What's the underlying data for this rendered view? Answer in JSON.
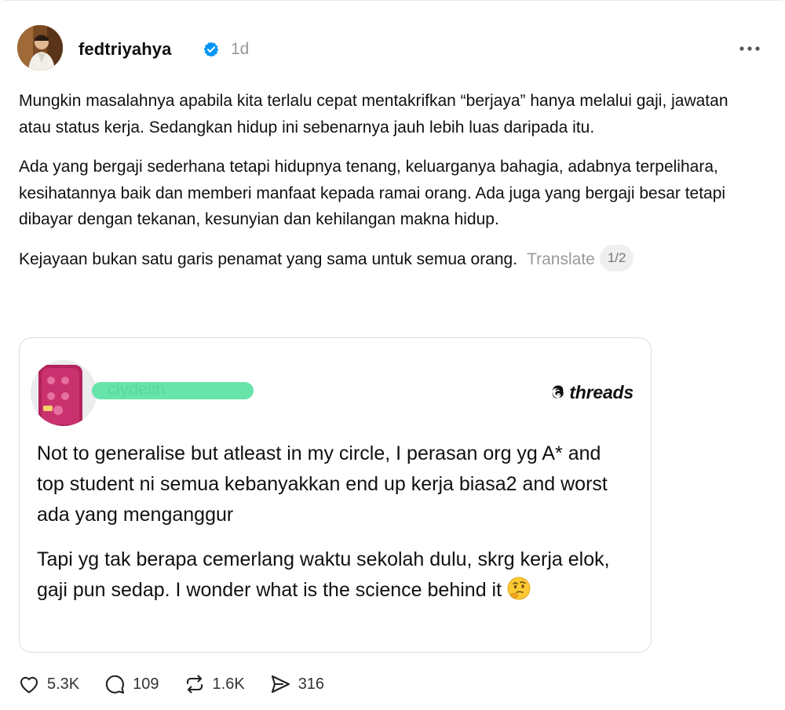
{
  "post": {
    "username": "fedtriyahya",
    "timestamp": "1d",
    "paragraphs": [
      "Mungkin masalahnya apabila kita terlalu cepat mentakrifkan “berjaya” hanya melalui gaji, jawatan atau status kerja. Sedangkan hidup ini sebenarnya jauh lebih luas daripada itu.",
      "Ada yang bergaji sederhana tetapi hidupnya tenang, keluarganya bahagia, adabnya terpelihara, kesihatannya baik dan memberi manfaat kepada ramai orang. Ada juga yang bergaji besar tetapi dibayar dengan tekanan, kesunyian dan kehilangan makna hidup.",
      "Kejayaan bukan satu garis penamat yang sama untuk semua orang."
    ],
    "translate_label": "Translate",
    "page_indicator": "1/2"
  },
  "quote": {
    "brand": "threads",
    "username": "clydelin",
    "paragraphs": [
      "Not to generalise but atleast in my circle, I perasan org yg A* and top student ni semua kebanyakkan end up kerja biasa2 and worst ada yang menganggur",
      "Tapi yg tak berapa cemerlang waktu sekolah dulu, skrg kerja elok, gaji pun sedap. I wonder what is the science behind it"
    ]
  },
  "actions": {
    "likes": "5.3K",
    "replies": "109",
    "reposts": "1.6K",
    "shares": "316"
  },
  "colors": {
    "verified": "#0095f6",
    "redaction": "#5fe3a5",
    "muted_text": "#9a9a9a"
  },
  "icons": {
    "verified": "verified-badge-icon",
    "more": "more-options-icon",
    "like": "heart-icon",
    "reply": "comment-icon",
    "repost": "repost-icon",
    "share": "send-icon",
    "emoji": "thinking-face-emoji"
  }
}
